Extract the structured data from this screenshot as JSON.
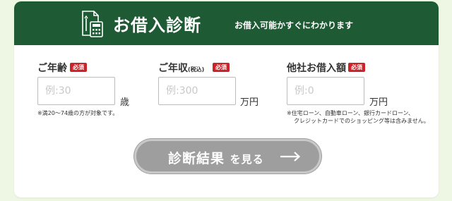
{
  "header": {
    "icon": "calculator-document-icon",
    "title": "お借入診断",
    "subtitle": "お借入可能かすぐにわかります"
  },
  "fields": {
    "age": {
      "label": "ご年齢",
      "badge": "必須",
      "placeholder": "例:30",
      "unit": "歳",
      "note": "※満20〜74歳の方が対象です。"
    },
    "income": {
      "label": "ご年収",
      "label_suffix": "(税込)",
      "badge": "必須",
      "placeholder": "例:300",
      "unit": "万円"
    },
    "other_loans": {
      "label": "他社お借入額",
      "badge": "必須",
      "placeholder": "例:0",
      "unit": "万円",
      "note_line1": "※住宅ローン、自動車ローン、銀行カードローン、",
      "note_line2": "クレジットカードでのショッピング等は含みません。"
    }
  },
  "button": {
    "label_main": "診断結果",
    "label_tail": "を見る",
    "icon": "arrow-right-icon"
  },
  "colors": {
    "page_bg": "#eef7e3",
    "header_bg": "#1e5a33",
    "badge": "#c8242a",
    "button": "#9e9e9e"
  }
}
